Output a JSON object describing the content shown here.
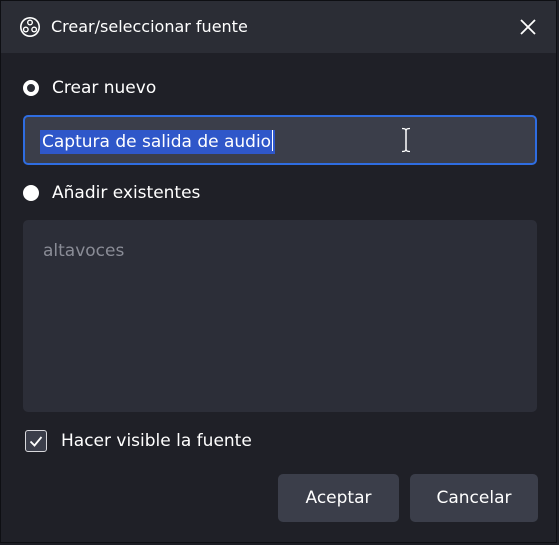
{
  "window": {
    "title": "Crear/seleccionar fuente",
    "app_icon": "obs-logo-icon",
    "close_icon": "close-icon"
  },
  "create_new": {
    "label": "Crear nuevo",
    "selected": true,
    "name_value": "Captura de salida de audio",
    "name_selected": true
  },
  "add_existing": {
    "label": "Añadir existentes",
    "selected": false,
    "items": [
      "altavoces"
    ]
  },
  "visible_checkbox": {
    "label": "Hacer visible la fuente",
    "checked": true
  },
  "buttons": {
    "accept": "Aceptar",
    "cancel": "Cancelar"
  },
  "colors": {
    "accent": "#2f6de1",
    "selection": "#2f57c9",
    "background": "#1f2027",
    "control": "#3b3e4a"
  }
}
